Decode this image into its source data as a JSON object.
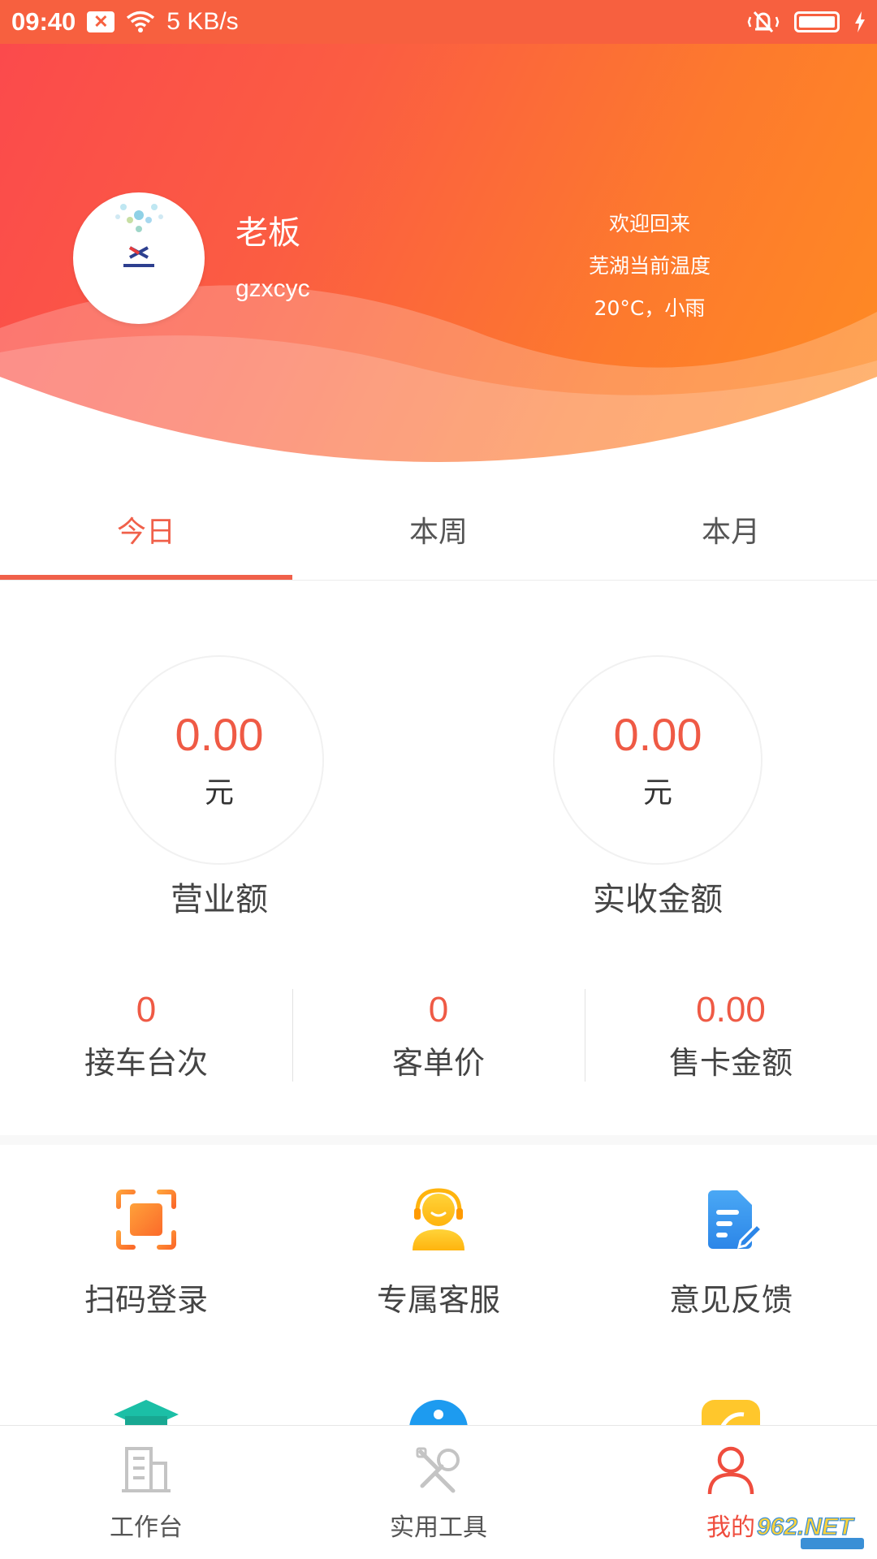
{
  "status_bar": {
    "time": "09:40",
    "net_speed": "5 KB/s"
  },
  "header": {
    "user_name": "老板",
    "user_id": "gzxcyc",
    "welcome": "欢迎回来",
    "location_temp": "芜湖当前温度",
    "weather": "20°C，小雨"
  },
  "tabs": [
    {
      "label": "今日",
      "active": true
    },
    {
      "label": "本周",
      "active": false
    },
    {
      "label": "本月",
      "active": false
    }
  ],
  "stats": [
    {
      "value": "0.00",
      "unit": "元",
      "label": "营业额"
    },
    {
      "value": "0.00",
      "unit": "元",
      "label": "实收金额"
    }
  ],
  "metrics": [
    {
      "value": "0",
      "label": "接车台次"
    },
    {
      "value": "0",
      "label": "客单价"
    },
    {
      "value": "0.00",
      "label": "售卡金额"
    }
  ],
  "tools": [
    {
      "label": "扫码登录",
      "icon": "scan-icon",
      "color": "#fb7a2e"
    },
    {
      "label": "专属客服",
      "icon": "customer-service-icon",
      "color": "#ffc21a"
    },
    {
      "label": "意见反馈",
      "icon": "feedback-icon",
      "color": "#3d9cf0"
    }
  ],
  "bottom_nav": [
    {
      "label": "工作台",
      "icon": "building-icon",
      "active": false
    },
    {
      "label": "实用工具",
      "icon": "tools-icon",
      "active": false
    },
    {
      "label": "我的",
      "icon": "user-icon",
      "active": true
    }
  ],
  "watermark": "962.NET",
  "colors": {
    "accent": "#ef5a45",
    "header_start": "#fb4a4c",
    "header_end": "#ff8c22"
  }
}
